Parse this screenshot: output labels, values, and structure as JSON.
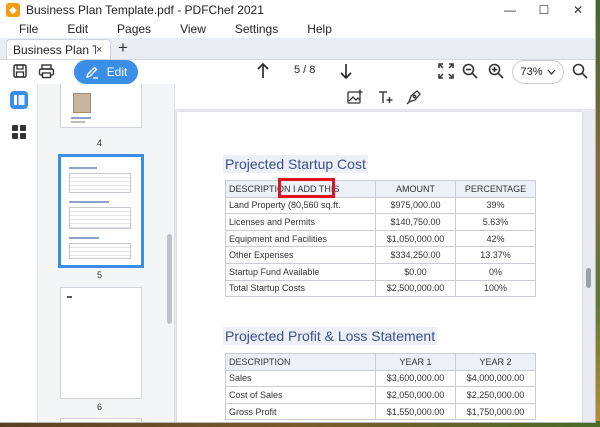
{
  "window": {
    "app_icon": "pdfchef-app-icon",
    "title": "Business Plan Template.pdf - PDFChef 2021",
    "controls": [
      "minimize-icon",
      "maximize-icon",
      "close-icon"
    ]
  },
  "menu": [
    "File",
    "Edit",
    "Pages",
    "View",
    "Settings",
    "Help"
  ],
  "tabs": [
    {
      "label": "Business Plan T...",
      "close": "×"
    }
  ],
  "tab_add": "+",
  "toolbar": {
    "save_icon": "save-icon",
    "print_icon": "print-icon",
    "edit_label": "Edit",
    "prev_icon": "arrow-up-icon",
    "page_indicator": "5 / 8",
    "next_icon": "arrow-down-icon",
    "fit_icon": "fit-screen-icon",
    "zoom_out_icon": "zoom-out-icon",
    "zoom_in_icon": "zoom-in-icon",
    "zoom_value": "73%",
    "search_icon": "search-icon",
    "accent": "#3a8ee6"
  },
  "rail": {
    "thumbnails_icon": "thumbnails-icon",
    "grid_icon": "grid-icon"
  },
  "thumbnails": [
    {
      "label": "4"
    },
    {
      "label": "5",
      "selected": true
    },
    {
      "label": "6"
    }
  ],
  "doc_tools": {
    "image_icon": "add-image-icon",
    "text_icon": "add-text-icon",
    "draw_icon": "draw-icon"
  },
  "document": {
    "section1": {
      "title": "Projected Startup Cost",
      "header": [
        "DESCRIPTION I ADD THIS",
        "AMOUNT",
        "PERCENTAGE"
      ],
      "rows": [
        [
          "Land Property (80,560 sq.ft.",
          "$975,000.00",
          "39%"
        ],
        [
          "Licenses and Permits",
          "$140,750.00",
          "5.63%"
        ],
        [
          "Equipment and Facilities",
          "$1,050,000.00",
          "42%"
        ],
        [
          "Other Expenses",
          "$334,250.00",
          "13.37%"
        ],
        [
          "Startup Fund Available",
          "$0.00",
          "0%"
        ],
        [
          "Total Startup Costs",
          "$2,500,000.00",
          "100%"
        ]
      ]
    },
    "section2": {
      "title": "Projected Profit & Loss Statement",
      "header": [
        "DESCRIPTION",
        "YEAR 1",
        "YEAR 2"
      ],
      "rows": [
        [
          "Sales",
          "$3,600,000.00",
          "$4,000,000.00"
        ],
        [
          "Cost of Sales",
          "$2,050,000.00",
          "$2,250,000.00"
        ],
        [
          "Gross Profit",
          "$1,550,000.00",
          "$1,750,000.00"
        ]
      ]
    },
    "highlight_color": "#e0141e"
  }
}
